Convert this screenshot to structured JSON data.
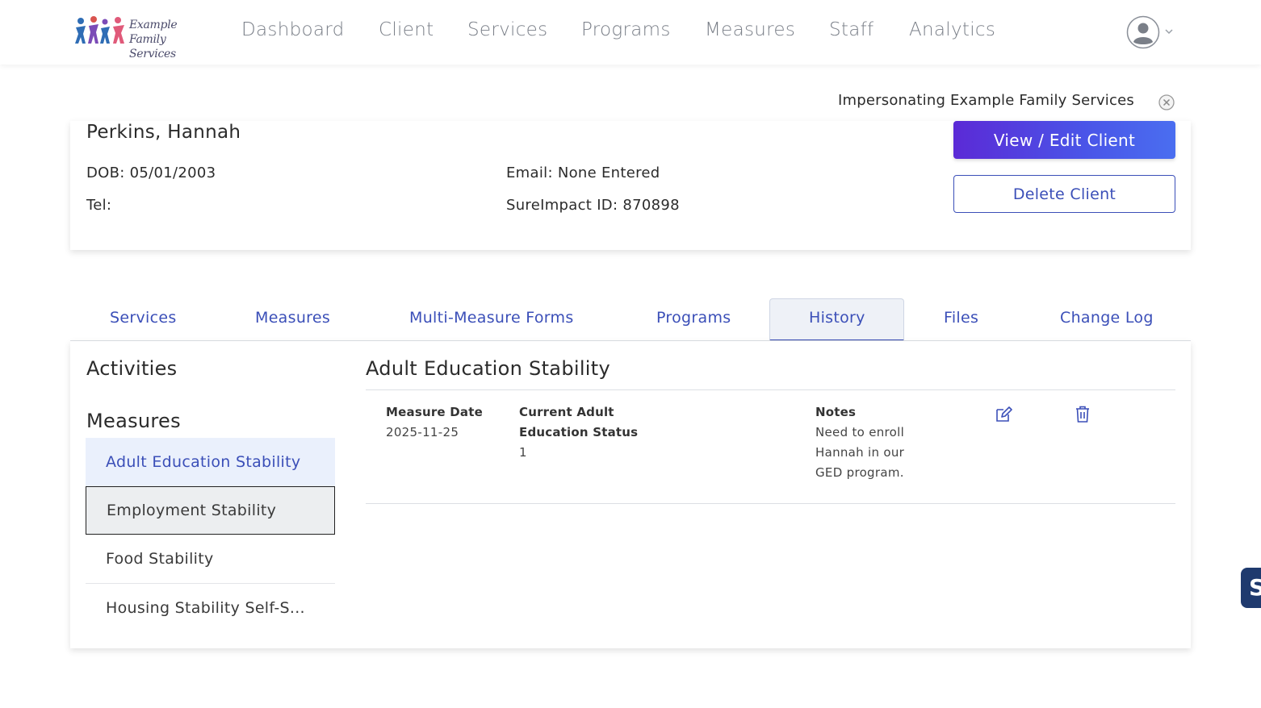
{
  "logo": {
    "line1": "Example",
    "line2": "Family Services"
  },
  "nav": {
    "items": [
      "Dashboard",
      "Client",
      "Services",
      "Programs",
      "Measures",
      "Staff",
      "Analytics"
    ]
  },
  "impersonation": {
    "text": "Impersonating Example Family Services"
  },
  "client": {
    "name": "Perkins, Hannah",
    "dob": "DOB: 05/01/2003",
    "tel": "Tel:",
    "email": "Email: None Entered",
    "sureimpact_id": "SureImpact ID: 870898",
    "view_edit_label": "View / Edit Client",
    "delete_label": "Delete Client"
  },
  "tabs": [
    "Services",
    "Measures",
    "Multi-Measure Forms",
    "Programs",
    "History",
    "Files",
    "Change Log"
  ],
  "active_tab": "History",
  "sidebar": {
    "activities_title": "Activities",
    "measures_title": "Measures",
    "items": [
      "Adult Education Stability",
      "Employment Stability",
      "Food Stability",
      "Housing Stability Self-S..."
    ]
  },
  "detail": {
    "title": "Adult Education Stability",
    "measure_date_label": "Measure Date",
    "measure_date_value": "2025-11-25",
    "status_label_line1": "Current Adult",
    "status_label_line2": "Education Status",
    "status_value": "1",
    "notes_label": "Notes",
    "notes_lines": [
      "Need to enroll",
      "Hannah in our",
      "GED program."
    ]
  },
  "float_tab": {
    "letter": "S"
  },
  "colors": {
    "accent": "#3b4fb8",
    "primary_gradient_start": "#5b2ad6",
    "primary_gradient_end": "#4a6ef0"
  }
}
